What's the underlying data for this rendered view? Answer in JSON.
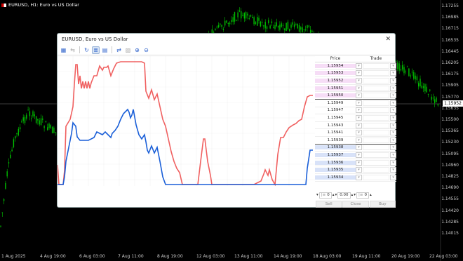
{
  "window": {
    "symbol_label": "EURUSD, H1:  Euro vs US Dollar"
  },
  "price_axis": [
    "1.17255",
    "1.16985",
    "1.16715",
    "1.16445",
    "1.16175",
    "1.15905",
    "1.15635",
    "1.15365",
    "1.15095",
    "1.14825",
    "1.14555",
    "1.14285",
    "1.14015",
    "1.16535",
    "1.16205",
    "1.15770",
    "1.15500",
    "1.15230",
    "1.14960",
    "1.14690",
    "1.14420"
  ],
  "current_price": "1.15952",
  "time_axis": [
    "1 Aug 2025",
    "4 Aug 19:00",
    "6 Aug 03:00",
    "7 Aug 11:00",
    "8 Aug 19:00",
    "12 Aug 03:00",
    "13 Aug 11:00",
    "14 Aug 19:00",
    "18 Aug 03:00",
    "19 Aug 11:00",
    "20 Aug 19:00",
    "22 Aug 03:00"
  ],
  "dialog": {
    "title": "EURUSD, Euro vs US Dollar",
    "close_icon": "close-icon",
    "toolbar_icons": [
      "chart-icon",
      "tick-icon",
      "refresh-icon",
      "depth-icon",
      "histogram-icon",
      "volume-icon",
      "settings-icon",
      "zoom-in-icon",
      "zoom-out-icon"
    ],
    "headers": {
      "price": "Price",
      "trade": "Trade"
    },
    "asks": [
      "1.15954",
      "1.15953",
      "1.15952",
      "1.15951",
      "1.15950"
    ],
    "mids": [
      "1.15949",
      "1.15947",
      "1.15945",
      "1.15943",
      "1.15941",
      "1.15939"
    ],
    "bids": [
      "1.15938",
      "1.15937",
      "1.15936",
      "1.15935",
      "1.15934"
    ],
    "controls": {
      "volume_left": "0",
      "price": "0.00",
      "volume_right": "0"
    },
    "buttons": {
      "sell": "Sell",
      "close": "Close",
      "buy": "Buy"
    }
  },
  "colors": {
    "ask_line": "#f06060",
    "bid_line": "#1a5fd8",
    "candle_up": "#00c000"
  }
}
